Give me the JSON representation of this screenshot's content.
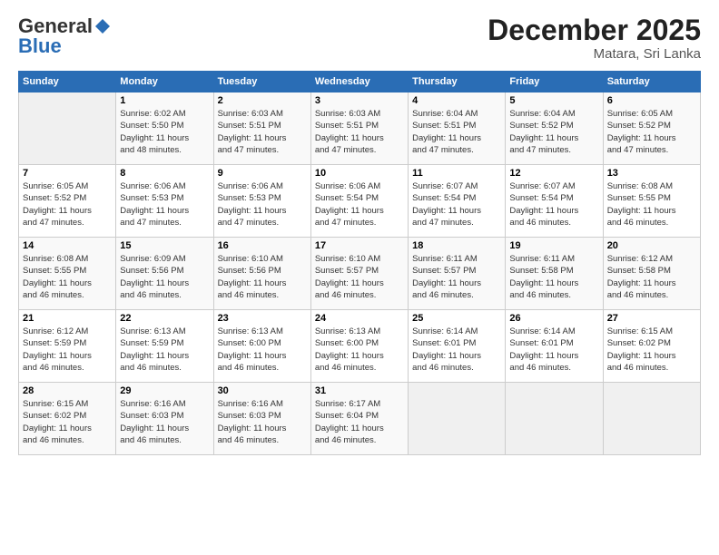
{
  "header": {
    "logo_general": "General",
    "logo_blue": "Blue",
    "month_title": "December 2025",
    "location": "Matara, Sri Lanka"
  },
  "days_of_week": [
    "Sunday",
    "Monday",
    "Tuesday",
    "Wednesday",
    "Thursday",
    "Friday",
    "Saturday"
  ],
  "weeks": [
    [
      {
        "day": "",
        "info": ""
      },
      {
        "day": "1",
        "info": "Sunrise: 6:02 AM\nSunset: 5:50 PM\nDaylight: 11 hours\nand 48 minutes."
      },
      {
        "day": "2",
        "info": "Sunrise: 6:03 AM\nSunset: 5:51 PM\nDaylight: 11 hours\nand 47 minutes."
      },
      {
        "day": "3",
        "info": "Sunrise: 6:03 AM\nSunset: 5:51 PM\nDaylight: 11 hours\nand 47 minutes."
      },
      {
        "day": "4",
        "info": "Sunrise: 6:04 AM\nSunset: 5:51 PM\nDaylight: 11 hours\nand 47 minutes."
      },
      {
        "day": "5",
        "info": "Sunrise: 6:04 AM\nSunset: 5:52 PM\nDaylight: 11 hours\nand 47 minutes."
      },
      {
        "day": "6",
        "info": "Sunrise: 6:05 AM\nSunset: 5:52 PM\nDaylight: 11 hours\nand 47 minutes."
      }
    ],
    [
      {
        "day": "7",
        "info": "Sunrise: 6:05 AM\nSunset: 5:52 PM\nDaylight: 11 hours\nand 47 minutes."
      },
      {
        "day": "8",
        "info": "Sunrise: 6:06 AM\nSunset: 5:53 PM\nDaylight: 11 hours\nand 47 minutes."
      },
      {
        "day": "9",
        "info": "Sunrise: 6:06 AM\nSunset: 5:53 PM\nDaylight: 11 hours\nand 47 minutes."
      },
      {
        "day": "10",
        "info": "Sunrise: 6:06 AM\nSunset: 5:54 PM\nDaylight: 11 hours\nand 47 minutes."
      },
      {
        "day": "11",
        "info": "Sunrise: 6:07 AM\nSunset: 5:54 PM\nDaylight: 11 hours\nand 47 minutes."
      },
      {
        "day": "12",
        "info": "Sunrise: 6:07 AM\nSunset: 5:54 PM\nDaylight: 11 hours\nand 46 minutes."
      },
      {
        "day": "13",
        "info": "Sunrise: 6:08 AM\nSunset: 5:55 PM\nDaylight: 11 hours\nand 46 minutes."
      }
    ],
    [
      {
        "day": "14",
        "info": "Sunrise: 6:08 AM\nSunset: 5:55 PM\nDaylight: 11 hours\nand 46 minutes."
      },
      {
        "day": "15",
        "info": "Sunrise: 6:09 AM\nSunset: 5:56 PM\nDaylight: 11 hours\nand 46 minutes."
      },
      {
        "day": "16",
        "info": "Sunrise: 6:10 AM\nSunset: 5:56 PM\nDaylight: 11 hours\nand 46 minutes."
      },
      {
        "day": "17",
        "info": "Sunrise: 6:10 AM\nSunset: 5:57 PM\nDaylight: 11 hours\nand 46 minutes."
      },
      {
        "day": "18",
        "info": "Sunrise: 6:11 AM\nSunset: 5:57 PM\nDaylight: 11 hours\nand 46 minutes."
      },
      {
        "day": "19",
        "info": "Sunrise: 6:11 AM\nSunset: 5:58 PM\nDaylight: 11 hours\nand 46 minutes."
      },
      {
        "day": "20",
        "info": "Sunrise: 6:12 AM\nSunset: 5:58 PM\nDaylight: 11 hours\nand 46 minutes."
      }
    ],
    [
      {
        "day": "21",
        "info": "Sunrise: 6:12 AM\nSunset: 5:59 PM\nDaylight: 11 hours\nand 46 minutes."
      },
      {
        "day": "22",
        "info": "Sunrise: 6:13 AM\nSunset: 5:59 PM\nDaylight: 11 hours\nand 46 minutes."
      },
      {
        "day": "23",
        "info": "Sunrise: 6:13 AM\nSunset: 6:00 PM\nDaylight: 11 hours\nand 46 minutes."
      },
      {
        "day": "24",
        "info": "Sunrise: 6:13 AM\nSunset: 6:00 PM\nDaylight: 11 hours\nand 46 minutes."
      },
      {
        "day": "25",
        "info": "Sunrise: 6:14 AM\nSunset: 6:01 PM\nDaylight: 11 hours\nand 46 minutes."
      },
      {
        "day": "26",
        "info": "Sunrise: 6:14 AM\nSunset: 6:01 PM\nDaylight: 11 hours\nand 46 minutes."
      },
      {
        "day": "27",
        "info": "Sunrise: 6:15 AM\nSunset: 6:02 PM\nDaylight: 11 hours\nand 46 minutes."
      }
    ],
    [
      {
        "day": "28",
        "info": "Sunrise: 6:15 AM\nSunset: 6:02 PM\nDaylight: 11 hours\nand 46 minutes."
      },
      {
        "day": "29",
        "info": "Sunrise: 6:16 AM\nSunset: 6:03 PM\nDaylight: 11 hours\nand 46 minutes."
      },
      {
        "day": "30",
        "info": "Sunrise: 6:16 AM\nSunset: 6:03 PM\nDaylight: 11 hours\nand 46 minutes."
      },
      {
        "day": "31",
        "info": "Sunrise: 6:17 AM\nSunset: 6:04 PM\nDaylight: 11 hours\nand 46 minutes."
      },
      {
        "day": "",
        "info": ""
      },
      {
        "day": "",
        "info": ""
      },
      {
        "day": "",
        "info": ""
      }
    ]
  ]
}
